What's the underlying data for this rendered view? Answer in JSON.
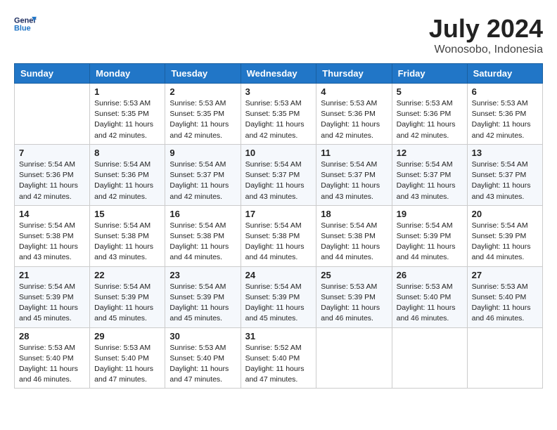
{
  "header": {
    "logo_line1": "General",
    "logo_line2": "Blue",
    "month_title": "July 2024",
    "location": "Wonosobo, Indonesia"
  },
  "days_of_week": [
    "Sunday",
    "Monday",
    "Tuesday",
    "Wednesday",
    "Thursday",
    "Friday",
    "Saturday"
  ],
  "weeks": [
    [
      {
        "day": "",
        "info": ""
      },
      {
        "day": "1",
        "info": "Sunrise: 5:53 AM\nSunset: 5:35 PM\nDaylight: 11 hours\nand 42 minutes."
      },
      {
        "day": "2",
        "info": "Sunrise: 5:53 AM\nSunset: 5:35 PM\nDaylight: 11 hours\nand 42 minutes."
      },
      {
        "day": "3",
        "info": "Sunrise: 5:53 AM\nSunset: 5:35 PM\nDaylight: 11 hours\nand 42 minutes."
      },
      {
        "day": "4",
        "info": "Sunrise: 5:53 AM\nSunset: 5:36 PM\nDaylight: 11 hours\nand 42 minutes."
      },
      {
        "day": "5",
        "info": "Sunrise: 5:53 AM\nSunset: 5:36 PM\nDaylight: 11 hours\nand 42 minutes."
      },
      {
        "day": "6",
        "info": "Sunrise: 5:53 AM\nSunset: 5:36 PM\nDaylight: 11 hours\nand 42 minutes."
      }
    ],
    [
      {
        "day": "7",
        "info": "Sunrise: 5:54 AM\nSunset: 5:36 PM\nDaylight: 11 hours\nand 42 minutes."
      },
      {
        "day": "8",
        "info": "Sunrise: 5:54 AM\nSunset: 5:36 PM\nDaylight: 11 hours\nand 42 minutes."
      },
      {
        "day": "9",
        "info": "Sunrise: 5:54 AM\nSunset: 5:37 PM\nDaylight: 11 hours\nand 42 minutes."
      },
      {
        "day": "10",
        "info": "Sunrise: 5:54 AM\nSunset: 5:37 PM\nDaylight: 11 hours\nand 43 minutes."
      },
      {
        "day": "11",
        "info": "Sunrise: 5:54 AM\nSunset: 5:37 PM\nDaylight: 11 hours\nand 43 minutes."
      },
      {
        "day": "12",
        "info": "Sunrise: 5:54 AM\nSunset: 5:37 PM\nDaylight: 11 hours\nand 43 minutes."
      },
      {
        "day": "13",
        "info": "Sunrise: 5:54 AM\nSunset: 5:37 PM\nDaylight: 11 hours\nand 43 minutes."
      }
    ],
    [
      {
        "day": "14",
        "info": "Sunrise: 5:54 AM\nSunset: 5:38 PM\nDaylight: 11 hours\nand 43 minutes."
      },
      {
        "day": "15",
        "info": "Sunrise: 5:54 AM\nSunset: 5:38 PM\nDaylight: 11 hours\nand 43 minutes."
      },
      {
        "day": "16",
        "info": "Sunrise: 5:54 AM\nSunset: 5:38 PM\nDaylight: 11 hours\nand 44 minutes."
      },
      {
        "day": "17",
        "info": "Sunrise: 5:54 AM\nSunset: 5:38 PM\nDaylight: 11 hours\nand 44 minutes."
      },
      {
        "day": "18",
        "info": "Sunrise: 5:54 AM\nSunset: 5:38 PM\nDaylight: 11 hours\nand 44 minutes."
      },
      {
        "day": "19",
        "info": "Sunrise: 5:54 AM\nSunset: 5:39 PM\nDaylight: 11 hours\nand 44 minutes."
      },
      {
        "day": "20",
        "info": "Sunrise: 5:54 AM\nSunset: 5:39 PM\nDaylight: 11 hours\nand 44 minutes."
      }
    ],
    [
      {
        "day": "21",
        "info": "Sunrise: 5:54 AM\nSunset: 5:39 PM\nDaylight: 11 hours\nand 45 minutes."
      },
      {
        "day": "22",
        "info": "Sunrise: 5:54 AM\nSunset: 5:39 PM\nDaylight: 11 hours\nand 45 minutes."
      },
      {
        "day": "23",
        "info": "Sunrise: 5:54 AM\nSunset: 5:39 PM\nDaylight: 11 hours\nand 45 minutes."
      },
      {
        "day": "24",
        "info": "Sunrise: 5:54 AM\nSunset: 5:39 PM\nDaylight: 11 hours\nand 45 minutes."
      },
      {
        "day": "25",
        "info": "Sunrise: 5:53 AM\nSunset: 5:39 PM\nDaylight: 11 hours\nand 46 minutes."
      },
      {
        "day": "26",
        "info": "Sunrise: 5:53 AM\nSunset: 5:40 PM\nDaylight: 11 hours\nand 46 minutes."
      },
      {
        "day": "27",
        "info": "Sunrise: 5:53 AM\nSunset: 5:40 PM\nDaylight: 11 hours\nand 46 minutes."
      }
    ],
    [
      {
        "day": "28",
        "info": "Sunrise: 5:53 AM\nSunset: 5:40 PM\nDaylight: 11 hours\nand 46 minutes."
      },
      {
        "day": "29",
        "info": "Sunrise: 5:53 AM\nSunset: 5:40 PM\nDaylight: 11 hours\nand 47 minutes."
      },
      {
        "day": "30",
        "info": "Sunrise: 5:53 AM\nSunset: 5:40 PM\nDaylight: 11 hours\nand 47 minutes."
      },
      {
        "day": "31",
        "info": "Sunrise: 5:52 AM\nSunset: 5:40 PM\nDaylight: 11 hours\nand 47 minutes."
      },
      {
        "day": "",
        "info": ""
      },
      {
        "day": "",
        "info": ""
      },
      {
        "day": "",
        "info": ""
      }
    ]
  ]
}
